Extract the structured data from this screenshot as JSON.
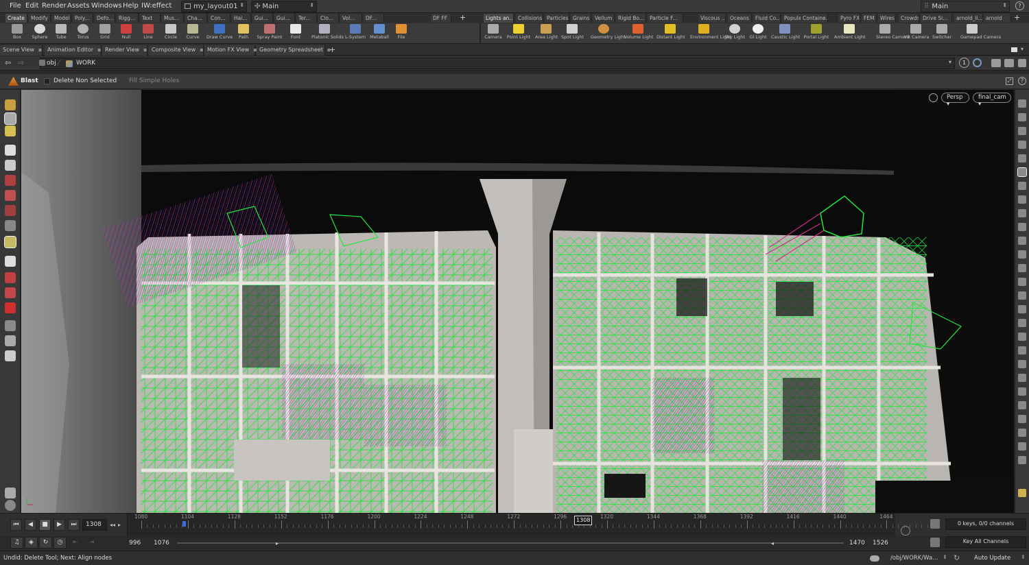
{
  "menubar": {
    "items": [
      "File",
      "Edit",
      "Render",
      "Assets",
      "Windows",
      "Help",
      "IW:effect"
    ],
    "desktop": "my_layout01",
    "context": "Main",
    "right_context": "Main"
  },
  "shelf_left": {
    "tabs": [
      "Create",
      "Modify",
      "Model",
      "Poly...",
      "Defo...",
      "Rigg...",
      "Text",
      "Mus...",
      "Cha...",
      "Con...",
      "Hai...",
      "Gui...",
      "Gui...",
      "Ter...",
      "Clo...",
      "Vol...",
      "DF...",
      "DF FF"
    ],
    "tools": [
      "Box",
      "Sphere",
      "Tube",
      "Torus",
      "Grid",
      "Null",
      "Line",
      "Circle",
      "Curve",
      "Draw Curve",
      "Path",
      "Spray Paint",
      "Font",
      "Platonic Solids",
      "L-System",
      "Metaball",
      "File"
    ]
  },
  "shelf_right": {
    "tabs": [
      "Lights an...",
      "Collisions",
      "Particles",
      "Grains",
      "Vellum",
      "Rigid Bo...",
      "Particle F...",
      "Viscous ...",
      "Oceans",
      "Fluid Co...",
      "Populate...",
      "Containe...",
      "Pyro FX",
      "FEM",
      "Wires",
      "Crowds",
      "Drive Si...",
      "arnold_li...",
      "arnold"
    ],
    "tools": [
      "Camera",
      "Point Light",
      "Area Light",
      "Spot Light",
      "Geometry Light",
      "Volume Light",
      "Distant Light",
      "Environment Light",
      "Sky Light",
      "GI Light",
      "Caustic Light",
      "Portal Light",
      "Ambient Light",
      "Stereo Camera",
      "VR Camera",
      "Switcher",
      "Gamepad Camera"
    ]
  },
  "pane_tabs": [
    "Scene View",
    "Animation Editor",
    "Render View",
    "Composite View",
    "Motion FX View",
    "Geometry Spreadsheet"
  ],
  "path": {
    "root": "obj",
    "node": "WORK"
  },
  "operation": {
    "tool": "Blast",
    "option1": "Delete Non Selected",
    "option2": "Fill Simple Holes"
  },
  "viewport": {
    "view_mode": "Persp",
    "camera": "final_cam"
  },
  "timeline": {
    "current_frame": "1308",
    "marker_frame": "1308",
    "ticks": [
      "1080",
      "1104",
      "1128",
      "1152",
      "1176",
      "1200",
      "1224",
      "1248",
      "1272",
      "1296",
      "1320",
      "1344",
      "1368",
      "1392",
      "1416",
      "1440",
      "1464"
    ],
    "keys_info": "0 keys, 0/0 channels",
    "key_button": "Key All Channels"
  },
  "range": {
    "start": "996",
    "start2": "1076",
    "end2": "1470",
    "end": "1526"
  },
  "status": {
    "message": "Undid: Delete Tool; Next: Align nodes",
    "path": "/obj/WORK/Wa...",
    "update": "Auto Update"
  },
  "colors": {
    "wire_green": "#22e63a",
    "wire_blue": "#2530d8",
    "wire_magenta": "#d0308a",
    "building": "#b7b3b0",
    "bg_dark": "#0d0d0d"
  }
}
